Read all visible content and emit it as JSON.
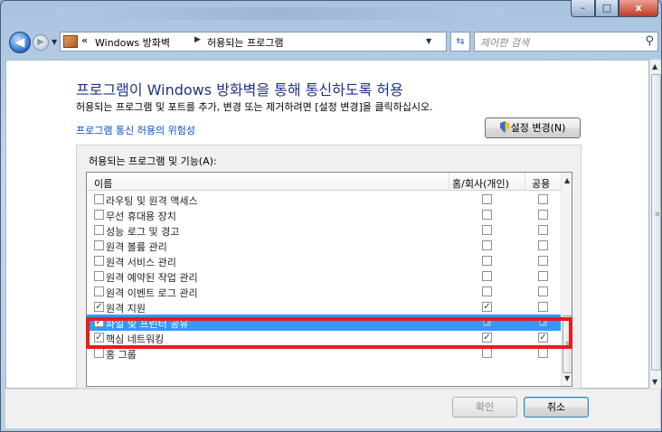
{
  "window": {
    "minimize_glyph": "–",
    "maximize_glyph": "□",
    "close_glyph": "x"
  },
  "nav": {
    "back_glyph": "◀",
    "forward_glyph": "▶",
    "breadcrumb": [
      "Windows 방화벽",
      "허용되는 프로그램"
    ],
    "breadcrumb_separator": "▶",
    "address_chevron": "«",
    "search_placeholder": "제어판 검색"
  },
  "page": {
    "heading": "프로그램이 Windows 방화벽을 통해 통신하도록 허용",
    "subline": "허용되는 프로그램 및 포트를 추가, 변경 또는 제거하려면 [설정 변경]을 클릭하십시오.",
    "risk_link": "프로그램 통신 허용의 위험성",
    "change_settings_label": "설정 변경(N)"
  },
  "programs": {
    "group_label": "허용되는 프로그램 및 기능(A):",
    "columns": {
      "name": "이름",
      "home": "홈/회사(개인)",
      "public": "공용"
    },
    "rows": [
      {
        "name": "라우팅 및 원격 액세스",
        "enabled": false,
        "home": false,
        "public": false
      },
      {
        "name": "무선 휴대용 장치",
        "enabled": false,
        "home": false,
        "public": false
      },
      {
        "name": "성능 로그 및 경고",
        "enabled": false,
        "home": false,
        "public": false
      },
      {
        "name": "원격 볼륨 관리",
        "enabled": false,
        "home": false,
        "public": false
      },
      {
        "name": "원격 서비스 관리",
        "enabled": false,
        "home": false,
        "public": false
      },
      {
        "name": "원격 예약된 작업 관리",
        "enabled": false,
        "home": false,
        "public": false
      },
      {
        "name": "원격 이벤트 로그 관리",
        "enabled": false,
        "home": false,
        "public": false
      },
      {
        "name": "원격 지원",
        "enabled": true,
        "home": true,
        "public": false
      },
      {
        "name": "파일 및 프린터 공유",
        "enabled": true,
        "home": true,
        "public": true,
        "selected": true
      },
      {
        "name": "핵심 네트워킹",
        "enabled": true,
        "home": true,
        "public": true
      },
      {
        "name": "홈 그룹",
        "enabled": false,
        "home": false,
        "public": false
      }
    ]
  },
  "footer": {
    "ok_label": "확인",
    "cancel_label": "취소"
  },
  "colors": {
    "selection": "#3399ff",
    "highlight_box": "#ea1c1c",
    "heading": "#1e3287",
    "link": "#0a4fc2"
  }
}
